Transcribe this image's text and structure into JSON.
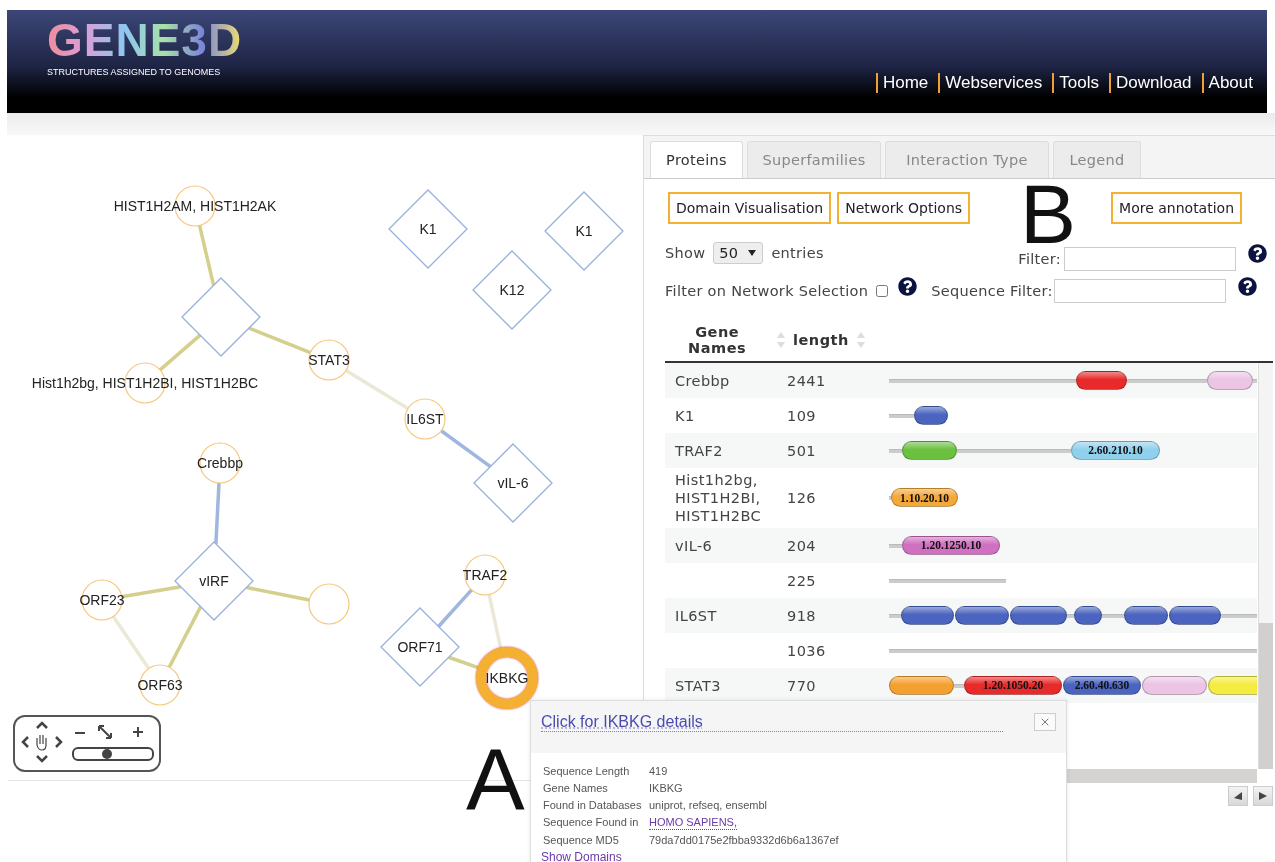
{
  "header": {
    "logo": "GENE3D",
    "tagline": "STRUCTURES ASSIGNED TO GENOMES",
    "nav": [
      "Home",
      "Webservices",
      "Tools",
      "Download",
      "About"
    ]
  },
  "network": {
    "nodes": [
      {
        "label": "HIST1H2AM, HIST1H2AK",
        "kind": "circle",
        "selected": false
      },
      {
        "kind": "diamond",
        "selected": false
      },
      {
        "label": "Hist1h2bg, HIST1H2BI, HIST1H2BC",
        "kind": "circle",
        "selected": false
      },
      {
        "label": "STAT3",
        "kind": "circle",
        "selected": false
      },
      {
        "label": "IL6ST",
        "kind": "circle",
        "selected": false
      },
      {
        "label": "vIL-6",
        "kind": "diamond",
        "selected": false
      },
      {
        "label": "K1",
        "kind": "diamond",
        "selected": false
      },
      {
        "label": "K1",
        "kind": "diamond",
        "selected": false
      },
      {
        "label": "K12",
        "kind": "diamond",
        "selected": false
      },
      {
        "label": "Crebbp",
        "kind": "circle",
        "selected": false
      },
      {
        "label": "vIRF",
        "kind": "diamond",
        "selected": false
      },
      {
        "label": "ORF23",
        "kind": "circle",
        "selected": false
      },
      {
        "kind": "circle",
        "selected": false
      },
      {
        "label": "ORF63",
        "kind": "circle",
        "selected": false
      },
      {
        "label": "TRAF2",
        "kind": "circle",
        "selected": false
      },
      {
        "label": "ORF71",
        "kind": "diamond",
        "selected": false
      },
      {
        "label": "IKBKG",
        "kind": "circle",
        "selected": true
      }
    ],
    "edges": [
      {
        "color": "#d4cf8c"
      },
      {
        "color": "#d4cf8c"
      },
      {
        "color": "#d4cf8c"
      },
      {
        "color": "#ebe9d6"
      },
      {
        "color": "#9fb6de"
      },
      {
        "color": "#9fb6de"
      },
      {
        "color": "#d4cf8c"
      },
      {
        "color": "#d4cf8c"
      },
      {
        "color": "#d4cf8c"
      },
      {
        "color": "#ebe9d6"
      },
      {
        "color": "#9fb6de"
      },
      {
        "color": "#ebe9d6"
      },
      {
        "color": "#d4cf8c"
      }
    ],
    "zoom_slider": {
      "level": 0.42
    }
  },
  "panel": {
    "tabs": [
      {
        "label": "Proteins",
        "selected": true
      },
      {
        "label": "Superfamilies",
        "selected": false
      },
      {
        "label": "Interaction Type",
        "selected": false
      },
      {
        "label": "Legend",
        "selected": false
      }
    ],
    "buttons": [
      "Domain Visualisation",
      "Network Options",
      "More annotation"
    ],
    "show_label": "Show",
    "page_size": "50",
    "entries_label": "entries",
    "filter_label": "Filter:",
    "network_filter_label": "Filter on Network Selection",
    "network_filter_checked": false,
    "sequence_filter_label": "Sequence Filter:"
  },
  "table": {
    "columns": [
      "Gene Names",
      "length"
    ],
    "rows": [
      {
        "gene_names": "Crebbp",
        "length": "2441",
        "domains": [
          {
            "color": "#e82a2a"
          },
          {
            "color": "#ecc4e4"
          }
        ]
      },
      {
        "gene_names": "K1",
        "length": "109",
        "domains": [
          {
            "color": "#4a64c0"
          }
        ]
      },
      {
        "gene_names": "TRAF2",
        "length": "501",
        "domains": [
          {
            "color": "#6cc040"
          },
          {
            "color": "#8fd0ec",
            "label": "2.60.210.10"
          }
        ]
      },
      {
        "gene_names": "Hist1h2bg, HIST1H2BI, HIST1H2BC",
        "length": "126",
        "domains": [
          {
            "color": "#f4a838",
            "label": "1.10.20.10"
          }
        ]
      },
      {
        "gene_names": "vIL-6",
        "length": "204",
        "domains": [
          {
            "color": "#d070c0",
            "label": "1.20.1250.10"
          }
        ]
      },
      {
        "gene_names": "",
        "length": "225",
        "domains": []
      },
      {
        "gene_names": "IL6ST",
        "length": "918",
        "domains": [
          {
            "color": "#4a64c0"
          },
          {
            "color": "#4a64c0"
          },
          {
            "color": "#4a64c0"
          },
          {
            "color": "#4a64c0"
          },
          {
            "color": "#4a64c0"
          },
          {
            "color": "#4a64c0"
          }
        ]
      },
      {
        "gene_names": "",
        "length": "1036",
        "domains": []
      },
      {
        "gene_names": "STAT3",
        "length": "770",
        "domains": [
          {
            "color": "#f4a030"
          },
          {
            "color": "#e82a2a",
            "label": "1.20.1050.20"
          },
          {
            "color": "#4a64c0",
            "label": "2.60.40.630"
          },
          {
            "color": "#ecc4e4"
          },
          {
            "color": "#f4ec40"
          }
        ]
      }
    ]
  },
  "popup": {
    "title": "Click for IKBKG details",
    "details": [
      {
        "label": "Sequence Length",
        "value": "419",
        "kind": "text"
      },
      {
        "label": "Gene Names",
        "value": "IKBKG",
        "kind": "text"
      },
      {
        "label": "Found in Databases",
        "value": "uniprot, refseq, ensembl",
        "kind": "text"
      },
      {
        "label": "Sequence Found in",
        "value": "HOMO SAPIENS,",
        "kind": "link"
      },
      {
        "label": "Sequence MD5",
        "value": "79da7dd0175e2fbba9332d6b6a1367ef",
        "kind": "text"
      }
    ],
    "show_domains": "Show Domains"
  },
  "annotations": [
    "A",
    "B"
  ]
}
